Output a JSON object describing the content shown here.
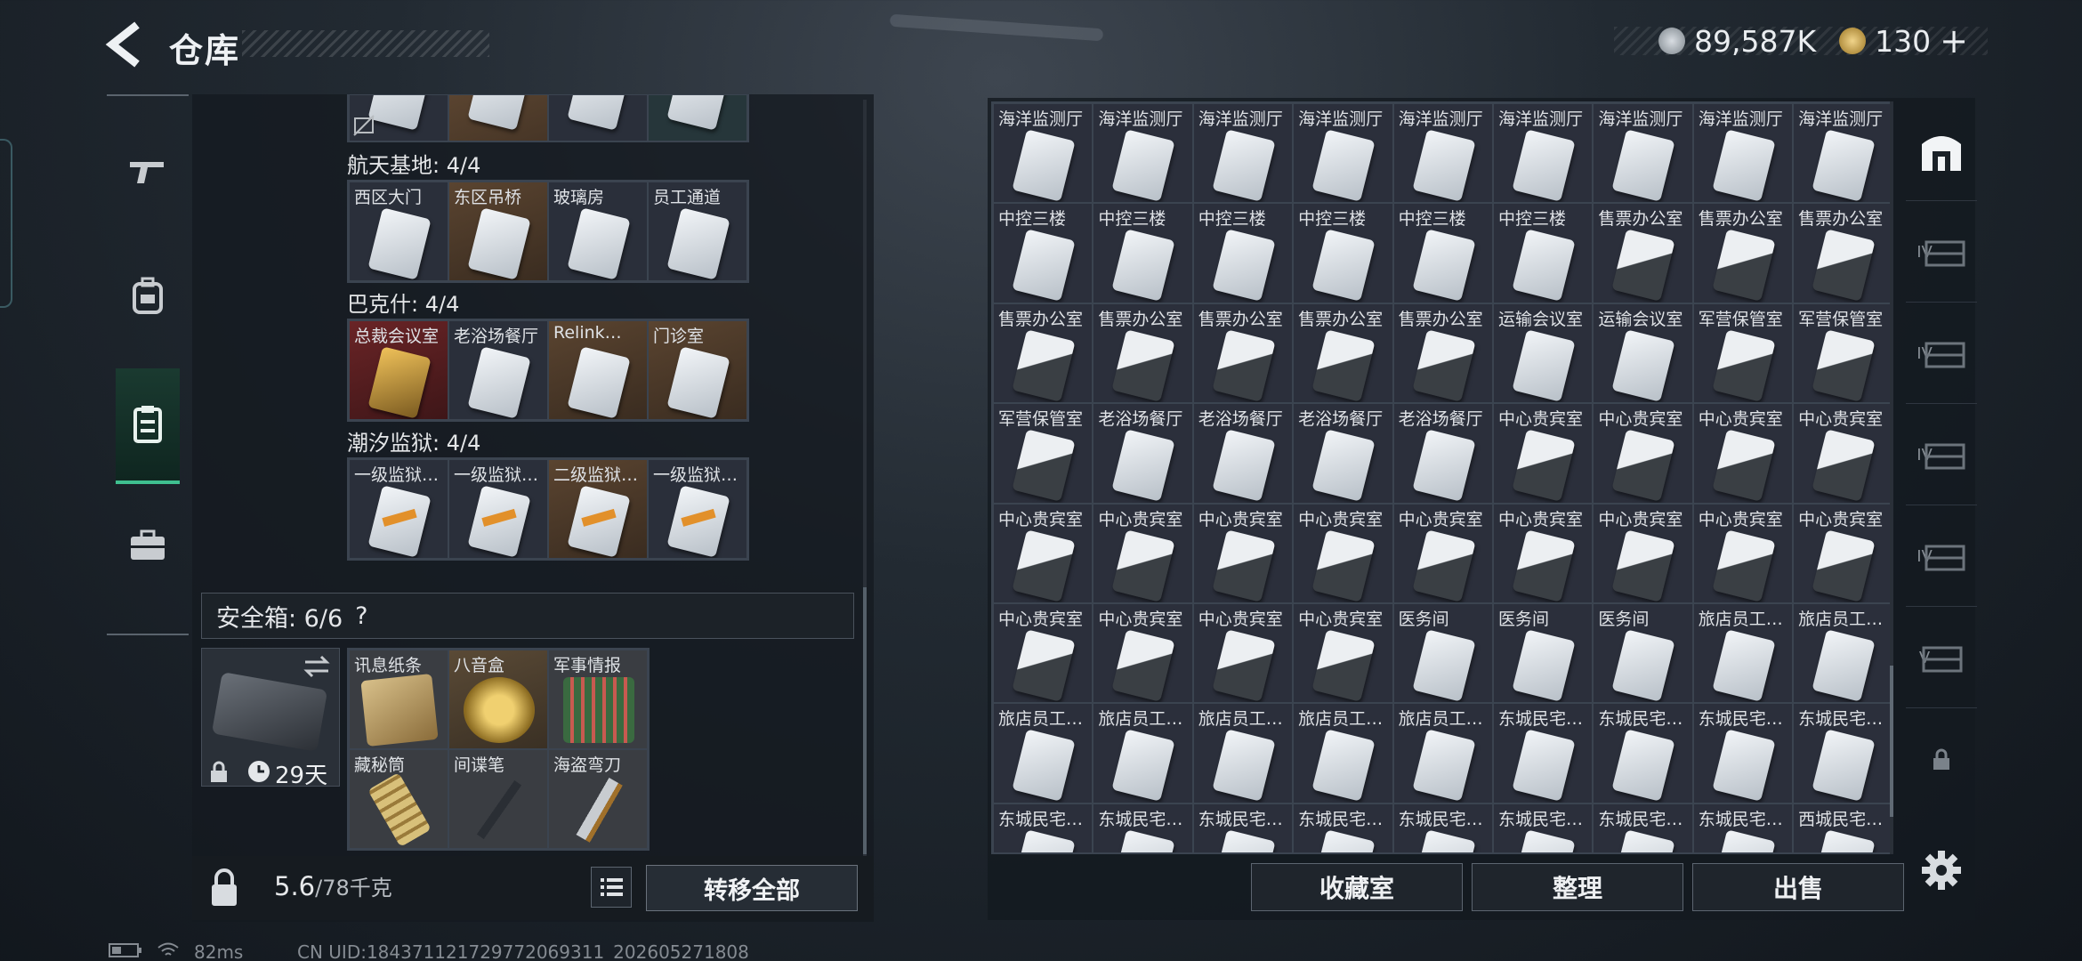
{
  "header": {
    "title": "仓库"
  },
  "currency": [
    {
      "icon": "silver-coin-icon",
      "value": "89,587K",
      "color": "#9aa3ab"
    },
    {
      "icon": "gold-coin-icon",
      "value": "130",
      "color": "#c9a24a"
    }
  ],
  "left_nav": [
    {
      "icon": "gun-icon"
    },
    {
      "icon": "backpack-icon"
    },
    {
      "icon": "storage-icon",
      "active": true
    },
    {
      "icon": "briefcase-icon"
    }
  ],
  "key_groups": [
    {
      "title": "航天基地: 4/4",
      "items": [
        {
          "label": "西区大门",
          "bg": "blue",
          "card": "white"
        },
        {
          "label": "东区吊桥",
          "bg": "gold",
          "card": "white"
        },
        {
          "label": "玻璃房",
          "bg": "blue",
          "card": "white"
        },
        {
          "label": "员工通道",
          "bg": "blue",
          "card": "white"
        }
      ]
    },
    {
      "title": "巴克什: 4/4",
      "items": [
        {
          "label": "总裁会议室",
          "bg": "red",
          "card": "gold"
        },
        {
          "label": "老浴场餐厅",
          "bg": "blue",
          "card": "white"
        },
        {
          "label": "Relink…",
          "bg": "gold",
          "card": "white"
        },
        {
          "label": "门诊室",
          "bg": "gold",
          "card": "white"
        }
      ]
    },
    {
      "title": "潮汐监狱: 4/4",
      "items": [
        {
          "label": "一级监狱…",
          "bg": "blue",
          "card": "orange"
        },
        {
          "label": "一级监狱…",
          "bg": "blue",
          "card": "orange"
        },
        {
          "label": "二级监狱…",
          "bg": "gold",
          "card": "orange"
        },
        {
          "label": "一级监狱…",
          "bg": "blue",
          "card": "orange"
        }
      ]
    }
  ],
  "safe": {
    "title": "安全箱: 6/6",
    "help": "?",
    "duration": "29天",
    "items": [
      {
        "label": "讯息纸条",
        "art": "paper"
      },
      {
        "label": "八音盒",
        "art": "music"
      },
      {
        "label": "军事情报",
        "art": "chip"
      },
      {
        "label": "藏秘筒",
        "art": "cylinder"
      },
      {
        "label": "间谍笔",
        "art": "pen"
      },
      {
        "label": "海盗弯刀",
        "art": "knife"
      }
    ]
  },
  "footer_left": {
    "weight": "5.6",
    "capacity": "/78千克",
    "transfer_label": "转移全部"
  },
  "storage_rows": [
    [
      "海洋监测厅",
      "海洋监测厅",
      "海洋监测厅",
      "海洋监测厅",
      "海洋监测厅",
      "海洋监测厅",
      "海洋监测厅",
      "海洋监测厅",
      "海洋监测厅"
    ],
    [
      "中控三楼",
      "中控三楼",
      "中控三楼",
      "中控三楼",
      "中控三楼",
      "中控三楼",
      "售票办公室",
      "售票办公室",
      "售票办公室"
    ],
    [
      "售票办公室",
      "售票办公室",
      "售票办公室",
      "售票办公室",
      "售票办公室",
      "运输会议室",
      "运输会议室",
      "军营保管室",
      "军营保管室"
    ],
    [
      "军营保管室",
      "老浴场餐厅",
      "老浴场餐厅",
      "老浴场餐厅",
      "老浴场餐厅",
      "中心贵宾室",
      "中心贵宾室",
      "中心贵宾室",
      "中心贵宾室"
    ],
    [
      "中心贵宾室",
      "中心贵宾室",
      "中心贵宾室",
      "中心贵宾室",
      "中心贵宾室",
      "中心贵宾室",
      "中心贵宾室",
      "中心贵宾室",
      "中心贵宾室"
    ],
    [
      "中心贵宾室",
      "中心贵宾室",
      "中心贵宾室",
      "中心贵宾室",
      "医务间",
      "医务间",
      "医务间",
      "旅店员工…",
      "旅店员工…"
    ],
    [
      "旅店员工…",
      "旅店员工…",
      "旅店员工…",
      "旅店员工…",
      "旅店员工…",
      "东城民宅…",
      "东城民宅…",
      "东城民宅…",
      "东城民宅…"
    ],
    [
      "东城民宅…",
      "东城民宅…",
      "东城民宅…",
      "东城民宅…",
      "东城民宅…",
      "东城民宅…",
      "东城民宅…",
      "东城民宅…",
      "西城民宅…"
    ]
  ],
  "right_buttons": {
    "collect": "收藏室",
    "sort": "整理",
    "sell": "出售"
  },
  "side_tabs": [
    {
      "icon": "storage-tab-icon"
    },
    {
      "label": "IV"
    },
    {
      "label": "IV"
    },
    {
      "label": "IV"
    },
    {
      "label": "IV"
    },
    {
      "label": "V"
    }
  ],
  "status": {
    "ping": "82ms",
    "uid": "CN UID:184371121729772069311_202605271808"
  }
}
